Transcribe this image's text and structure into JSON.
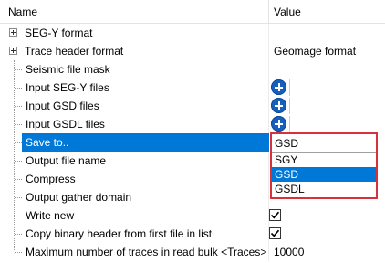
{
  "header": {
    "name": "Name",
    "value": "Value"
  },
  "rows": {
    "segy_format": {
      "label": "SEG-Y format"
    },
    "trace_header_format": {
      "label": "Trace header format",
      "value": "Geomage format"
    },
    "seismic_file_mask": {
      "label": "Seismic file mask"
    },
    "input_segy_files": {
      "label": "Input SEG-Y files"
    },
    "input_gsd_files": {
      "label": "Input GSD files"
    },
    "input_gsdl_files": {
      "label": "Input GSDL files"
    },
    "save_to": {
      "label": "Save to.."
    },
    "output_file_name": {
      "label": "Output file name"
    },
    "compress": {
      "label": "Compress"
    },
    "output_gather_domain": {
      "label": "Output gather domain"
    },
    "write_new": {
      "label": "Write new",
      "checked": true
    },
    "copy_binary_header": {
      "label": "Copy binary header from first file in list",
      "checked": true
    },
    "max_traces": {
      "label": "Maximum number of traces in read bulk <Traces>",
      "value": "10000"
    }
  },
  "dropdown": {
    "current": "GSD",
    "options": [
      "SGY",
      "GSD",
      "GSDL"
    ],
    "selected": "GSD"
  },
  "colors": {
    "selection": "#0078d7",
    "highlight_border": "#d9303e",
    "add_button": "#1560bd"
  },
  "icons": {
    "expander": "plus-box-icon",
    "add": "plus-circle-icon",
    "check": "checkmark-icon"
  }
}
